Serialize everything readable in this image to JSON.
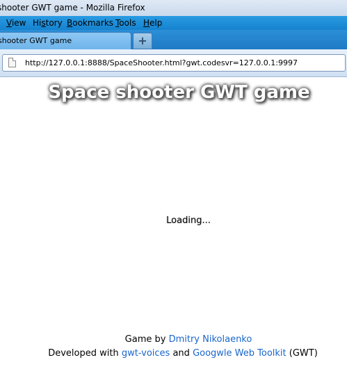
{
  "window": {
    "title": "shooter GWT game - Mozilla Firefox"
  },
  "menu": {
    "items": [
      {
        "label": "View",
        "key": "V",
        "rest": "iew"
      },
      {
        "label": "History",
        "key": "s",
        "pre": "Hi",
        "rest": "tory"
      },
      {
        "label": "Bookmarks",
        "key": "B",
        "rest": "ookmarks"
      },
      {
        "label": "Tools",
        "key": "T",
        "rest": "ools"
      },
      {
        "label": "Help",
        "key": "H",
        "rest": "elp"
      }
    ]
  },
  "tabs": {
    "active_label": "shooter GWT game",
    "new_tab_symbol": "+"
  },
  "navbar": {
    "url": "http://127.0.0.1:8888/SpaceShooter.html?gwt.codesvr=127.0.0.1:9997"
  },
  "page": {
    "title": "Space shooter GWT game",
    "loading": "Loading...",
    "footer": {
      "game_by_prefix": "Game by ",
      "author_link": "Dmitry Nikolaenko",
      "developed_prefix": "Developed with ",
      "lib_link": "gwt-voices",
      "and_text": " and ",
      "toolkit_link": "Googwle Web Toolkit",
      "suffix": " (GWT)"
    }
  },
  "colors": {
    "link": "#1a66cc",
    "menubar": "#1682cf"
  }
}
